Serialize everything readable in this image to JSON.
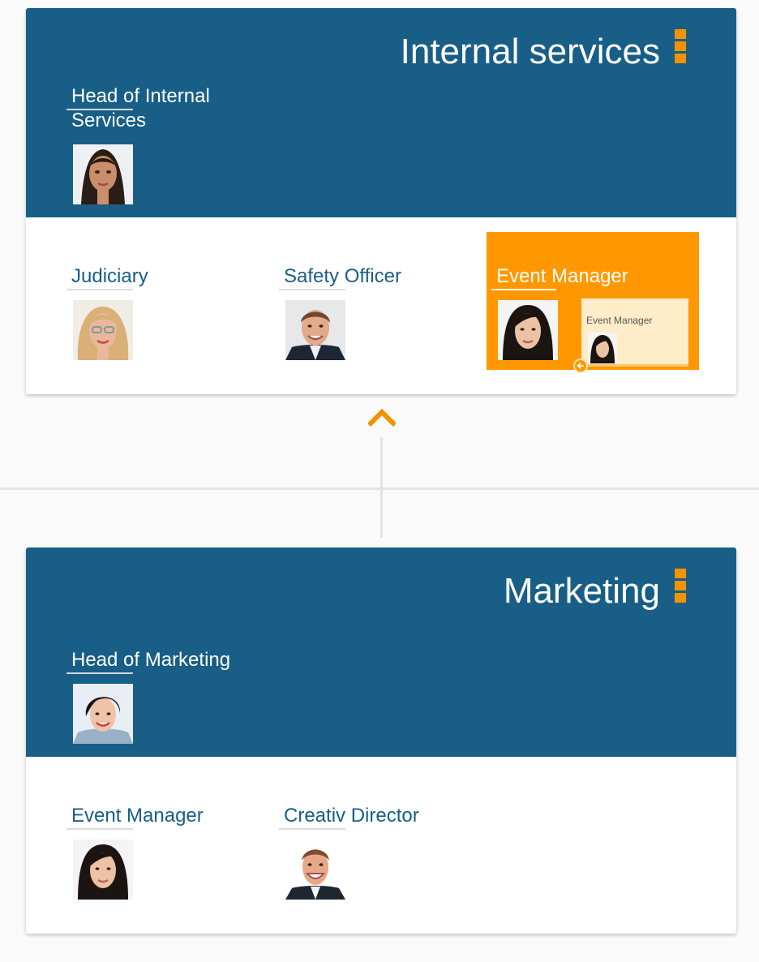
{
  "colors": {
    "header": "#185e86",
    "accent": "#ff9800",
    "card": "#ffffff"
  },
  "internal": {
    "title": "Internal services",
    "menu_icon": "menu-bars-icon",
    "head": {
      "role": "Head of Internal Services"
    },
    "members": [
      {
        "role": "Judiciary"
      },
      {
        "role": "Safety Officer"
      },
      {
        "role": "Event Manager"
      }
    ],
    "popup": {
      "label": "Event Manager",
      "back_icon": "arrow-left-icon"
    }
  },
  "nav": {
    "up_icon": "chevron-up-icon"
  },
  "marketing": {
    "title": "Marketing",
    "menu_icon": "menu-bars-icon",
    "head": {
      "role": "Head of Marketing"
    },
    "members": [
      {
        "role": "Event Manager"
      },
      {
        "role": "Creativ Director"
      }
    ]
  }
}
